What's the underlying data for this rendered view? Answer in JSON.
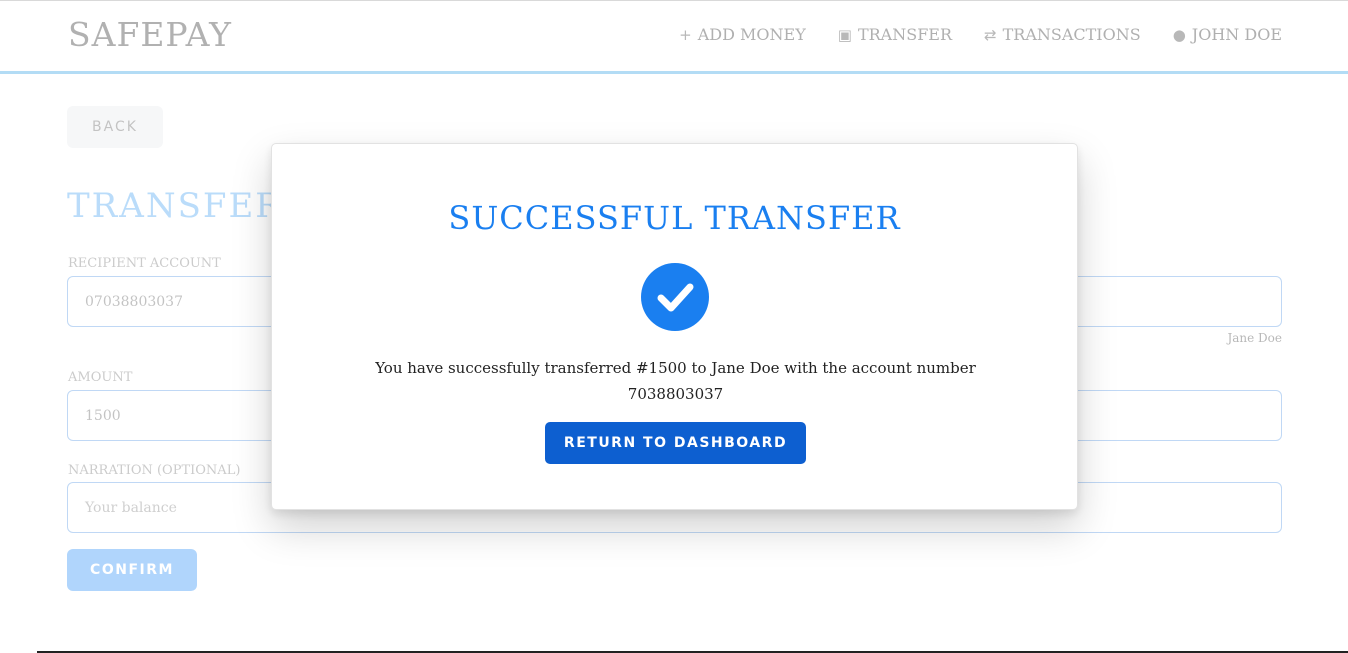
{
  "header": {
    "brand": "SAFEPAY",
    "nav": [
      {
        "icon": "plus-icon",
        "glyph": "+",
        "label": "ADD MONEY"
      },
      {
        "icon": "money-icon",
        "glyph": "▣",
        "label": "TRANSFER"
      },
      {
        "icon": "swap-icon",
        "glyph": "⇄",
        "label": "TRANSACTIONS"
      },
      {
        "icon": "user-icon",
        "glyph": "●",
        "label": "JOHN DOE"
      }
    ]
  },
  "form": {
    "back_label": "BACK",
    "title": "TRANSFER I",
    "recipient": {
      "label": "RECIPIENT ACCOUNT",
      "value": "07038803037",
      "hint": "Jane Doe"
    },
    "amount": {
      "label": "AMOUNT",
      "value": "1500"
    },
    "narration": {
      "label": "NARRATION (OPTIONAL)",
      "placeholder": "Your balance"
    },
    "confirm_label": "CONFIRM"
  },
  "modal": {
    "title": "SUCCESSFUL TRANSFER",
    "message_line1": "You have successfully transferred #1500 to Jane Doe with the account number",
    "message_line2": "7038803037",
    "button_label": "RETURN TO DASHBOARD",
    "accent": "#1a7ff0",
    "button_color": "#0d5fd0"
  }
}
